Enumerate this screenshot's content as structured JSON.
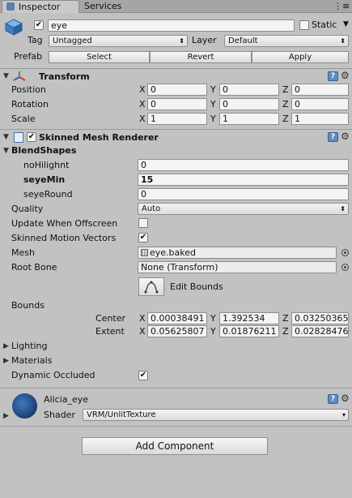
{
  "tabs": [
    {
      "label": "Inspector"
    },
    {
      "label": "Services"
    }
  ],
  "header": {
    "name": "eye",
    "static_label": "Static",
    "tag_label": "Tag",
    "tag_value": "Untagged",
    "layer_label": "Layer",
    "layer_value": "Default",
    "prefab_label": "Prefab",
    "select_label": "Select",
    "revert_label": "Revert",
    "apply_label": "Apply"
  },
  "transform": {
    "title": "Transform",
    "position_label": "Position",
    "rotation_label": "Rotation",
    "scale_label": "Scale",
    "position": [
      "0",
      "0",
      "0"
    ],
    "rotation": [
      "0",
      "0",
      "0"
    ],
    "scale": [
      "1",
      "1",
      "1"
    ],
    "axes": [
      "X",
      "Y",
      "Z"
    ]
  },
  "smr": {
    "title": "Skinned Mesh Renderer",
    "blendshapes_label": "BlendShapes",
    "blendshapes": [
      {
        "label": "noHilighnt",
        "value": "0"
      },
      {
        "label": "seyeMin",
        "value": "15"
      },
      {
        "label": "seyeRound",
        "value": "0"
      }
    ],
    "quality_label": "Quality",
    "quality_value": "Auto",
    "update_offscreen_label": "Update When Offscreen",
    "motion_vectors_label": "Skinned Motion Vectors",
    "mesh_label": "Mesh",
    "mesh_value": "eye.baked",
    "root_bone_label": "Root Bone",
    "root_bone_value": "None (Transform)",
    "edit_bounds_label": "Edit Bounds",
    "bounds_label": "Bounds",
    "center_label": "Center",
    "extent_label": "Extent",
    "center": [
      "0.00038491",
      "1.392534",
      "0.03250365"
    ],
    "extent": [
      "0.05625807",
      "0.01876211",
      "0.02828476"
    ],
    "lighting_label": "Lighting",
    "materials_label": "Materials",
    "dynamic_occluded_label": "Dynamic Occluded"
  },
  "material": {
    "name": "Alicia_eye",
    "shader_label": "Shader",
    "shader_value": "VRM/UnlitTexture"
  },
  "add_component_label": "Add Component",
  "colors": {
    "accent": "#3d6fb0",
    "background": "#c2c2c2"
  }
}
